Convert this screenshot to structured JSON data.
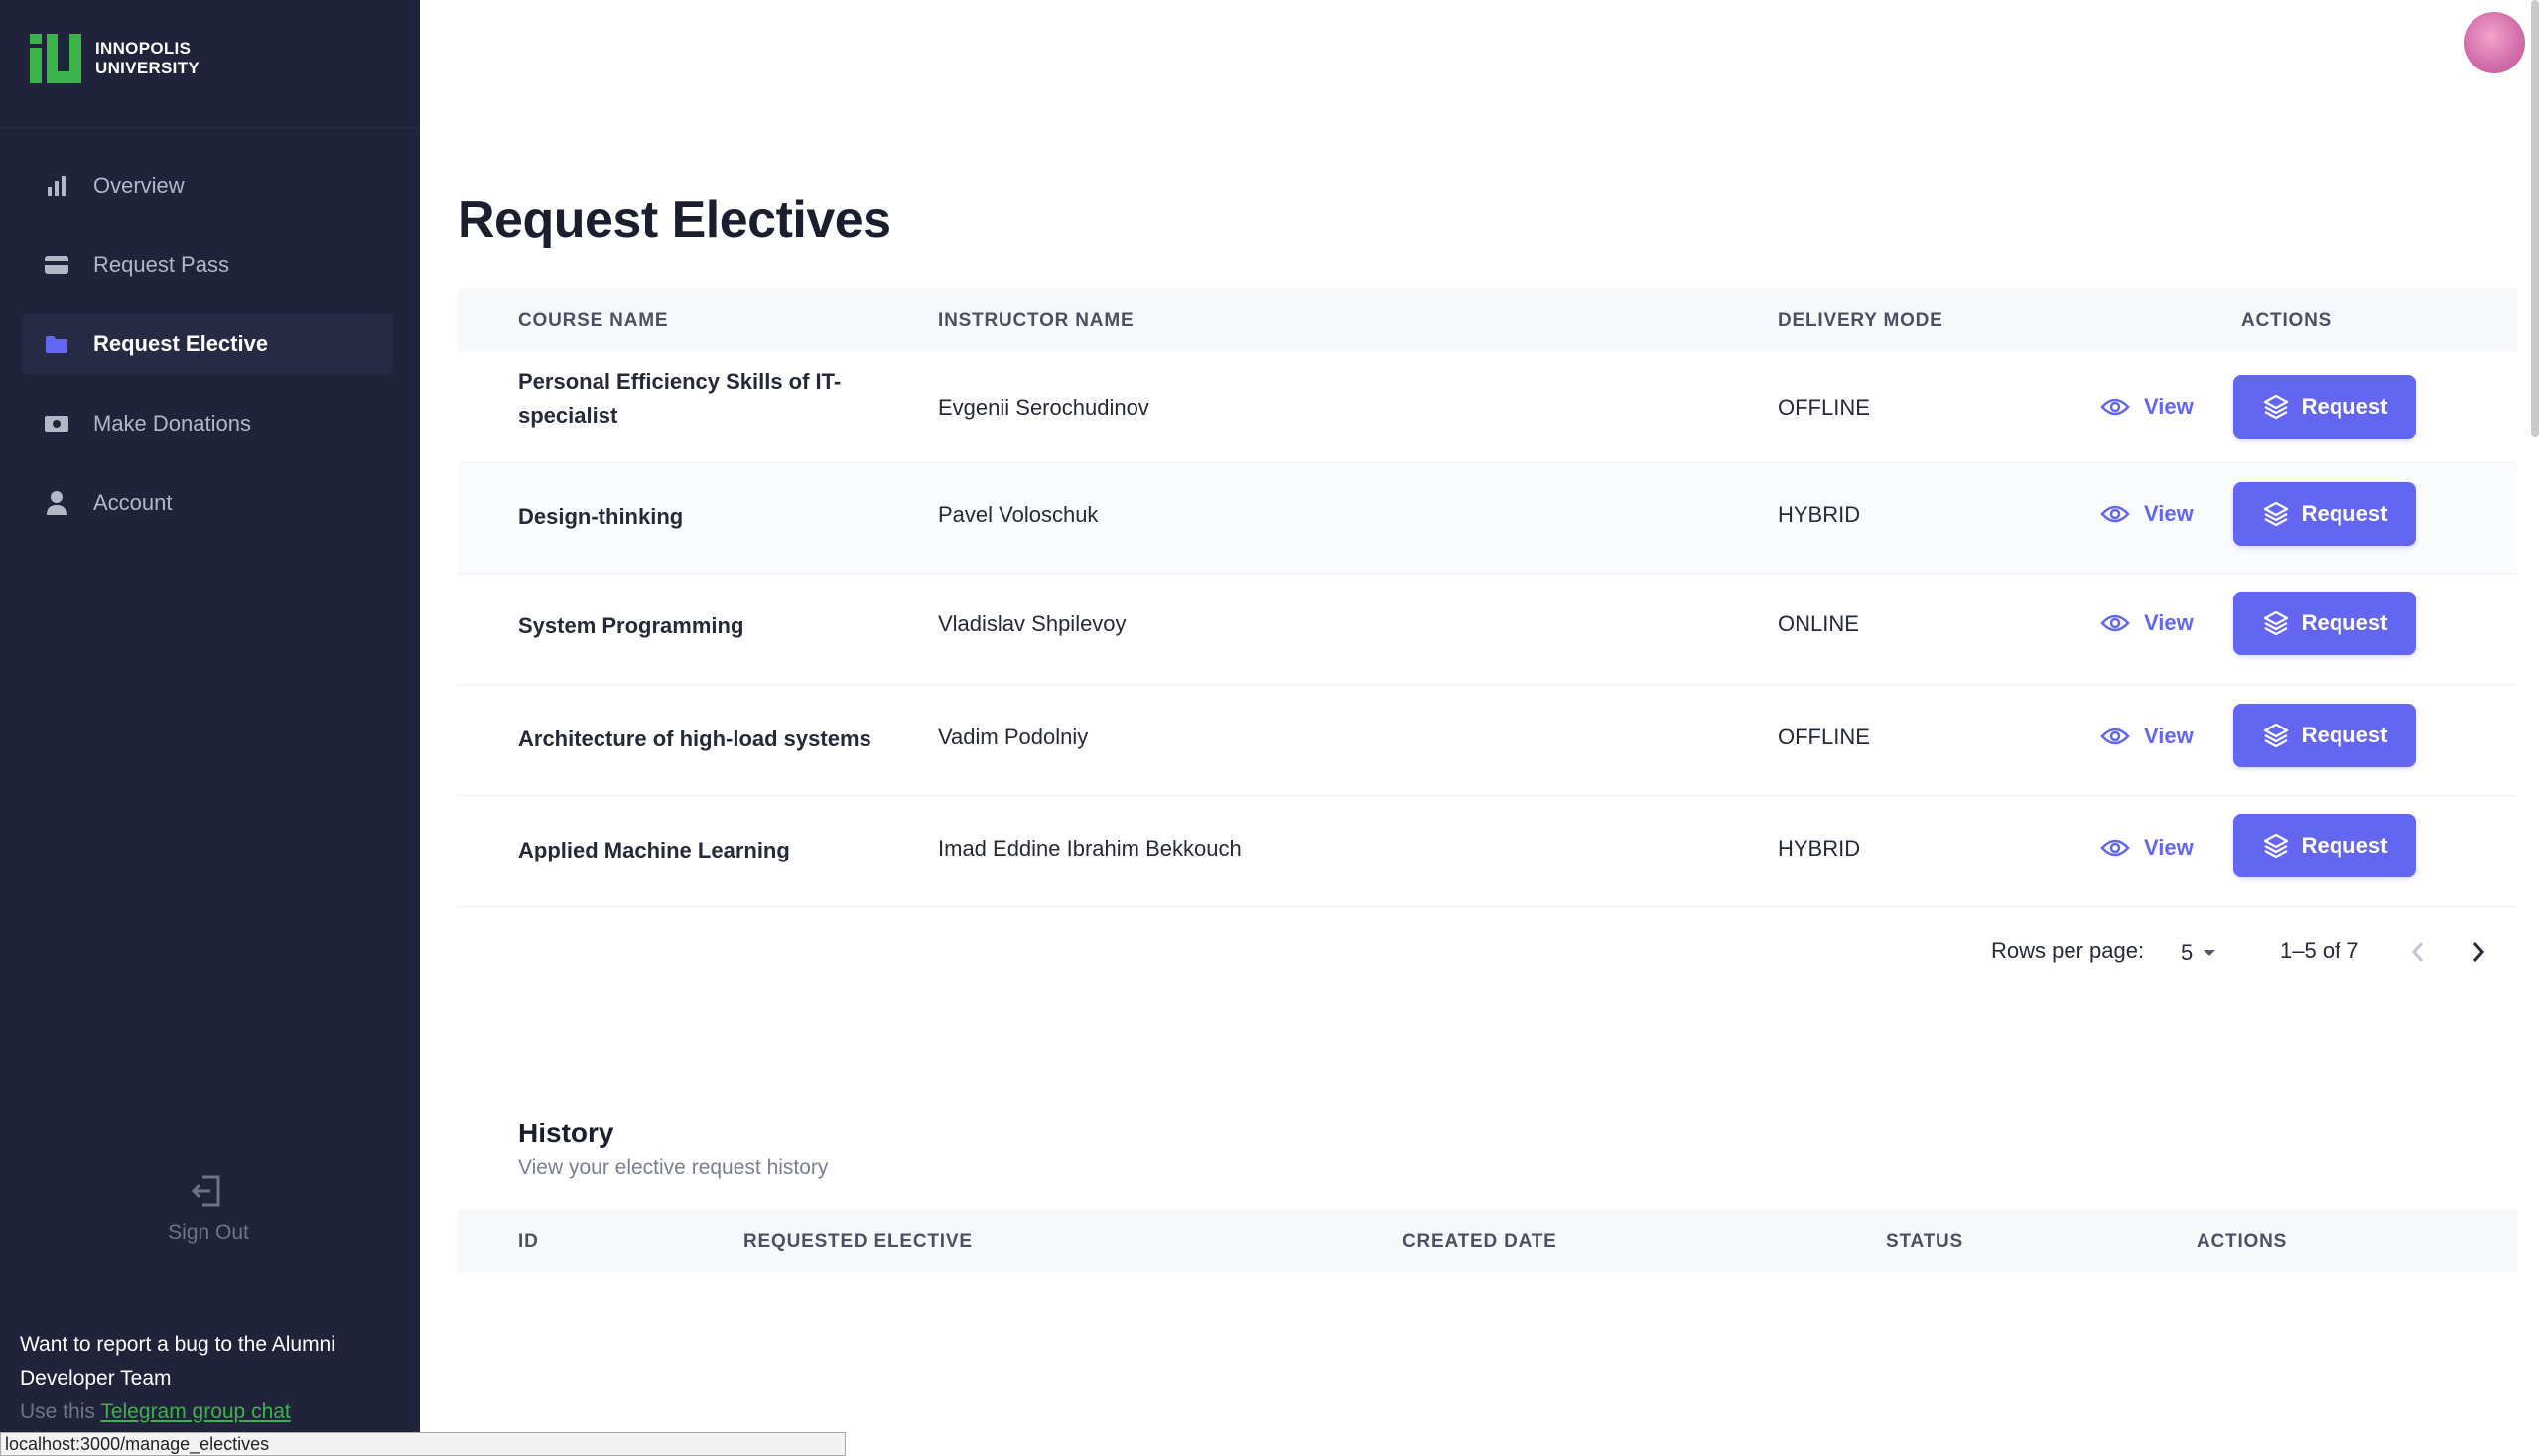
{
  "brand": {
    "line1": "INNOPOLIS",
    "line2": "UNIVERSITY"
  },
  "sidebar": {
    "items": [
      {
        "label": "Overview",
        "icon": "bar-chart-icon",
        "active": false
      },
      {
        "label": "Request Pass",
        "icon": "card-icon",
        "active": false
      },
      {
        "label": "Request Elective",
        "icon": "folder-icon",
        "active": true
      },
      {
        "label": "Make Donations",
        "icon": "money-icon",
        "active": false
      },
      {
        "label": "Account",
        "icon": "user-icon",
        "active": false
      }
    ],
    "sign_out": "Sign Out",
    "bug_report": {
      "text": "Want to report a bug to the Alumni Developer Team",
      "prefix": "Use this",
      "link": "Telegram group chat"
    }
  },
  "status_url": "localhost:3000/manage_electives",
  "page_title": "Request Electives",
  "table": {
    "headers": {
      "course": "COURSE NAME",
      "instructor": "INSTRUCTOR NAME",
      "mode": "DELIVERY MODE",
      "actions": "ACTIONS"
    },
    "view_label": "View",
    "request_label": "Request",
    "rows": [
      {
        "course": "Personal Efficiency Skills of IT-specialist",
        "instructor": "Evgenii Serochudinov",
        "mode": "OFFLINE"
      },
      {
        "course": "Design-thinking",
        "instructor": "Pavel Voloschuk",
        "mode": "HYBRID"
      },
      {
        "course": "System Programming",
        "instructor": "Vladislav Shpilevoy",
        "mode": "ONLINE"
      },
      {
        "course": "Architecture of high-load systems",
        "instructor": "Vadim Podolniy",
        "mode": "OFFLINE"
      },
      {
        "course": "Applied Machine Learning",
        "instructor": "Imad Eddine Ibrahim Bekkouch",
        "mode": "HYBRID"
      }
    ],
    "pagination": {
      "rows_per_page_label": "Rows per page:",
      "rows_per_page": "5",
      "range": "1–5 of 7"
    }
  },
  "history": {
    "title": "History",
    "subtitle": "View your elective request history",
    "headers": {
      "id": "ID",
      "elective": "REQUESTED ELECTIVE",
      "created": "CREATED DATE",
      "status": "STATUS",
      "actions": "ACTIONS"
    }
  },
  "colors": {
    "sidebar_bg": "#20233a",
    "accent": "#6366f1",
    "brand_green": "#3cb34a"
  }
}
